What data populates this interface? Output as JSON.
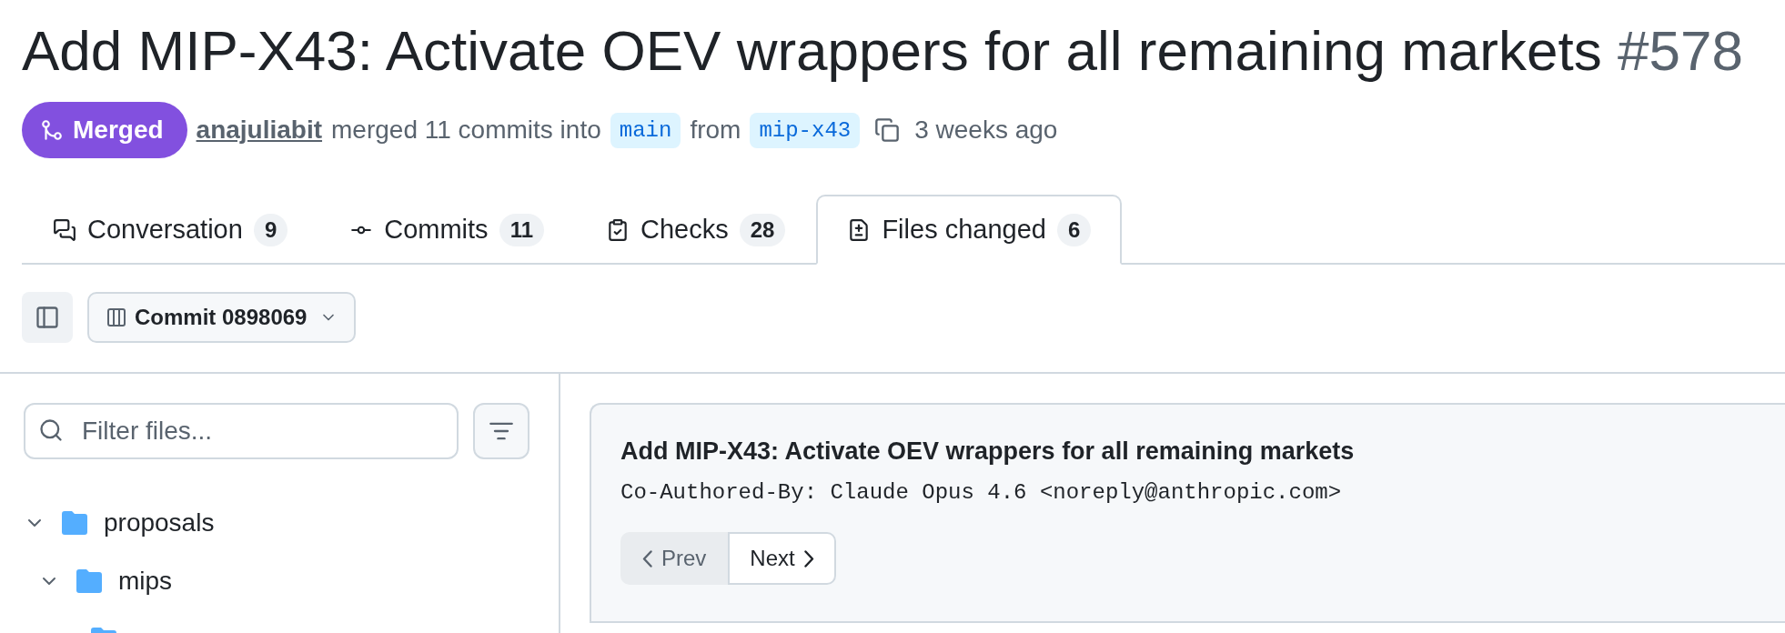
{
  "pull_request": {
    "title": "Add MIP-X43: Activate OEV wrappers for all remaining markets",
    "number": "#578",
    "state": "Merged",
    "author": "anajuliabit",
    "action": "merged 11 commits into",
    "base_branch": "main",
    "from_label": "from",
    "head_branch": "mip-x43",
    "time": "3 weeks ago"
  },
  "tabs": [
    {
      "kind": "conversation",
      "label": "Conversation",
      "count": "9",
      "selected": false
    },
    {
      "kind": "commits",
      "label": "Commits",
      "count": "11",
      "selected": false
    },
    {
      "kind": "checks",
      "label": "Checks",
      "count": "28",
      "selected": false
    },
    {
      "kind": "files",
      "label": "Files changed",
      "count": "6",
      "selected": true
    }
  ],
  "toolbar": {
    "commit_button": "Commit 0898069"
  },
  "file_tree": {
    "filter": {
      "placeholder": "Filter files..."
    },
    "items": [
      {
        "kind": "folder",
        "label": "proposals",
        "expanded": true,
        "children": [
          {
            "kind": "folder",
            "label": "mips",
            "expanded": true,
            "children": [
              {
                "kind": "folder"
              }
            ]
          }
        ]
      }
    ]
  },
  "commit": {
    "title": "Add MIP-X43: Activate OEV wrappers for all remaining markets",
    "body": "Co-Authored-By: Claude Opus 4.6 <noreply@anthropic.com>",
    "buttons": [
      {
        "kind": "prev",
        "label": "Prev",
        "disabled": true
      },
      {
        "kind": "next",
        "label": "Next",
        "disabled": false
      }
    ]
  }
}
